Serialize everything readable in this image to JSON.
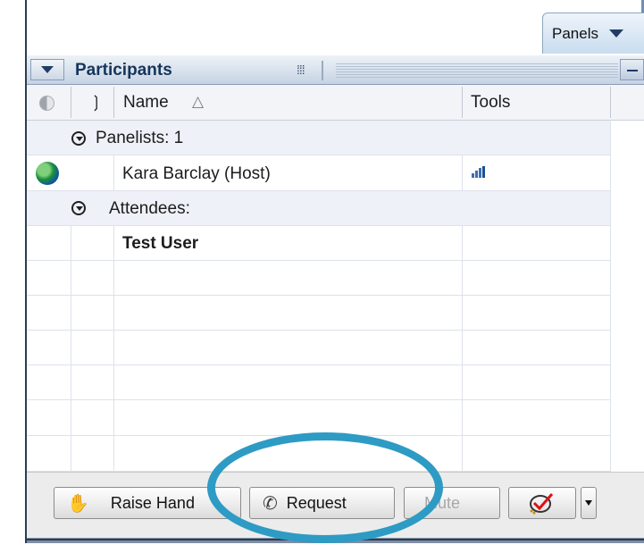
{
  "toolbar_top": {
    "panels_label": "Panels"
  },
  "participants": {
    "title": "Participants",
    "columns": {
      "name": "Name",
      "sort_indicator": "△",
      "tools": "Tools"
    },
    "groups": [
      {
        "label": "Panelists: 1",
        "members": [
          {
            "name": "Kara Barclay (Host)"
          }
        ]
      },
      {
        "label": "Attendees:",
        "members": [
          {
            "name": "Test User"
          }
        ]
      }
    ]
  },
  "actions": {
    "raise_hand": "Raise Hand",
    "request": "Request",
    "mute": "Mute"
  },
  "colors": {
    "annotation_circle": "#2e9bc4",
    "header_text": "#15365c"
  }
}
